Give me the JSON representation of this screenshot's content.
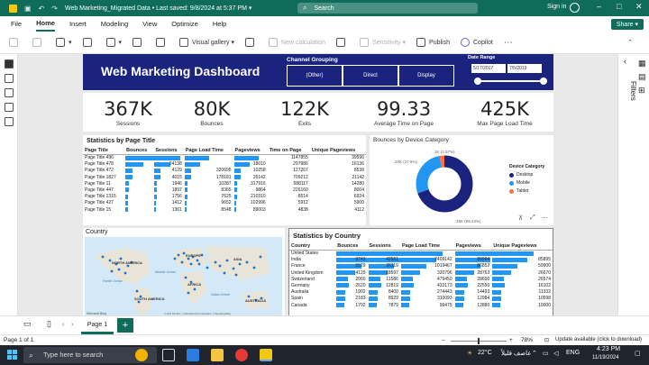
{
  "titlebar": {
    "title": "Web Marketing_Migrated Data • Last saved: 9/8/2024 at 5:37 PM ▾",
    "search_placeholder": "Search",
    "signin": "Sign in"
  },
  "menu": [
    "File",
    "Home",
    "Insert",
    "Modeling",
    "View",
    "Optimize",
    "Help"
  ],
  "share_label": "Share ▾",
  "ribbon": {
    "visual_gallery": "Visual gallery",
    "new_calculation": "New calculation",
    "sensitivity": "Sensitivity",
    "publish": "Publish",
    "copilot": "Copilot"
  },
  "rightrail": {
    "filters": "Filters"
  },
  "dashboard": {
    "title": "Web Marketing Dashboard",
    "channel_grouping_label": "Channel Grouping",
    "channels": [
      "(Other)",
      "Direct",
      "Display"
    ],
    "date_range_label": "Date Range",
    "date_start": "5/17/2017",
    "date_end": "7/5/2019"
  },
  "kpis": [
    {
      "value": "367K",
      "label": "Sessions"
    },
    {
      "value": "80K",
      "label": "Bounces"
    },
    {
      "value": "122K",
      "label": "Exits"
    },
    {
      "value": "99.33",
      "label": "Average Time on Page"
    },
    {
      "value": "425K",
      "label": "Max Page Load Time"
    }
  ],
  "page_stats": {
    "title": "Statistics by Page Title",
    "headers": [
      "Page Title",
      "Bounces",
      "Sessions",
      "Page Load Time",
      "Pageviews",
      "Time on Page",
      "Unique Pageviews"
    ],
    "rows": [
      [
        "Page Title 496",
        "",
        "",
        "",
        "",
        "1147855",
        "39596"
      ],
      [
        "Page Title 478",
        "",
        "24138",
        "",
        "18010",
        "297986",
        "16136"
      ],
      [
        "Page Title 472",
        "",
        "4129",
        "320695",
        "10258",
        "127267",
        "8538"
      ],
      [
        "Page Title 1827",
        "",
        "4015",
        "178181",
        "26142",
        "709212",
        "21142"
      ],
      [
        "Page Title 11",
        "",
        "1946",
        "10287",
        "317916",
        "588117",
        "14280"
      ],
      [
        "Page Title 447",
        "",
        "1897",
        "8365",
        "9864",
        "226160",
        "8004"
      ],
      [
        "Page Title 1315",
        "",
        "1756",
        "7625",
        "210310",
        "8514",
        "6924"
      ],
      [
        "Page Title 427",
        "",
        "1412",
        "9652",
        "102996",
        "5912",
        "5900"
      ],
      [
        "Page Title 15",
        "",
        "1361",
        "8548",
        "89003",
        "4838",
        "4112"
      ]
    ]
  },
  "device": {
    "title": "Bounces by Device Category",
    "legend_title": "Device Category",
    "categories": [
      "Desktop",
      "Mobile",
      "Tablet"
    ],
    "colors": [
      "#1a237e",
      "#2196f3",
      "#ff7043"
    ],
    "labels": [
      "2K (2.97%)",
      "20K (27.6%)",
      "48K (69.43%)"
    ]
  },
  "country_map": {
    "title": "Country",
    "labels": [
      "NORTH AMERICA",
      "EUROPE",
      "ASIA",
      "AFRICA",
      "SOUTH AMERICA",
      "AUSTRALIA",
      "Pacific Ocean",
      "Atlantic Ocean",
      "Indian Ocean"
    ],
    "provider": "Microsoft Bing",
    "copyright": "© 2024 TomTom, © 2024 Microsoft Corporation, © OpenStreetMap"
  },
  "country_stats": {
    "title": "Statistics by Country",
    "headers": [
      "Country",
      "Bounces",
      "Sessions",
      "Page Load Time",
      "Pageviews",
      "Unique Pageviews"
    ],
    "rows": [
      [
        "United States",
        "",
        "",
        "",
        "",
        ""
      ],
      [
        "India",
        "9743",
        "42561",
        "2409142",
        "89994",
        "85895"
      ],
      [
        "France",
        "5529",
        "35119",
        "1019467",
        "86852",
        "59900"
      ],
      [
        "United Kingdom",
        "4129",
        "18597",
        "320796",
        "28763",
        "26670"
      ],
      [
        "Switzerland",
        "2060",
        "11586",
        "479450",
        "28600",
        "26574"
      ],
      [
        "Germany",
        "2620",
        "12819",
        "433173",
        "22550",
        "16102"
      ],
      [
        "Australia",
        "1902",
        "8400",
        "274443",
        "14493",
        "11332"
      ],
      [
        "Spain",
        "2183",
        "8929",
        "310093",
        "12984",
        "10598"
      ],
      [
        "Canada",
        "1792",
        "7879",
        "99475",
        "12880",
        "10000"
      ]
    ]
  },
  "pagetabs": {
    "tab": "Page 1",
    "add": "+"
  },
  "status": {
    "page": "Page 1 of 1",
    "zoom": "78%",
    "update": "Update available (click to download)"
  },
  "taskbar": {
    "search": "Type here to search",
    "weather": "22°C",
    "weather_text": "عاصف قليلاً",
    "lang": "ENG",
    "time": "4:23 PM",
    "date": "11/19/2024"
  }
}
